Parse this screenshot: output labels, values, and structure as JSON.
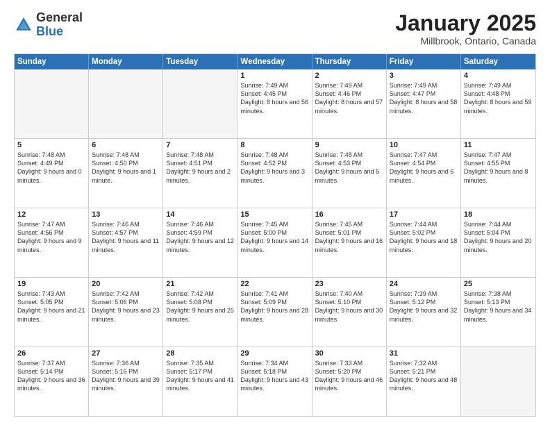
{
  "logo": {
    "general": "General",
    "blue": "Blue"
  },
  "header": {
    "title": "January 2025",
    "location": "Millbrook, Ontario, Canada"
  },
  "weekdays": [
    "Sunday",
    "Monday",
    "Tuesday",
    "Wednesday",
    "Thursday",
    "Friday",
    "Saturday"
  ],
  "weeks": [
    [
      {
        "day": "",
        "empty": true
      },
      {
        "day": "",
        "empty": true
      },
      {
        "day": "",
        "empty": true
      },
      {
        "day": "1",
        "sunrise": "7:49 AM",
        "sunset": "4:45 PM",
        "daylight": "8 hours and 56 minutes."
      },
      {
        "day": "2",
        "sunrise": "7:49 AM",
        "sunset": "4:46 PM",
        "daylight": "8 hours and 57 minutes."
      },
      {
        "day": "3",
        "sunrise": "7:49 AM",
        "sunset": "4:47 PM",
        "daylight": "8 hours and 58 minutes."
      },
      {
        "day": "4",
        "sunrise": "7:49 AM",
        "sunset": "4:48 PM",
        "daylight": "8 hours and 59 minutes."
      }
    ],
    [
      {
        "day": "5",
        "sunrise": "7:48 AM",
        "sunset": "4:49 PM",
        "daylight": "9 hours and 0 minutes."
      },
      {
        "day": "6",
        "sunrise": "7:48 AM",
        "sunset": "4:50 PM",
        "daylight": "9 hours and 1 minute."
      },
      {
        "day": "7",
        "sunrise": "7:48 AM",
        "sunset": "4:51 PM",
        "daylight": "9 hours and 2 minutes."
      },
      {
        "day": "8",
        "sunrise": "7:48 AM",
        "sunset": "4:52 PM",
        "daylight": "9 hours and 3 minutes."
      },
      {
        "day": "9",
        "sunrise": "7:48 AM",
        "sunset": "4:53 PM",
        "daylight": "9 hours and 5 minutes."
      },
      {
        "day": "10",
        "sunrise": "7:47 AM",
        "sunset": "4:54 PM",
        "daylight": "9 hours and 6 minutes."
      },
      {
        "day": "11",
        "sunrise": "7:47 AM",
        "sunset": "4:55 PM",
        "daylight": "9 hours and 8 minutes."
      }
    ],
    [
      {
        "day": "12",
        "sunrise": "7:47 AM",
        "sunset": "4:56 PM",
        "daylight": "9 hours and 9 minutes."
      },
      {
        "day": "13",
        "sunrise": "7:46 AM",
        "sunset": "4:57 PM",
        "daylight": "9 hours and 11 minutes."
      },
      {
        "day": "14",
        "sunrise": "7:46 AM",
        "sunset": "4:59 PM",
        "daylight": "9 hours and 12 minutes."
      },
      {
        "day": "15",
        "sunrise": "7:45 AM",
        "sunset": "5:00 PM",
        "daylight": "9 hours and 14 minutes."
      },
      {
        "day": "16",
        "sunrise": "7:45 AM",
        "sunset": "5:01 PM",
        "daylight": "9 hours and 16 minutes."
      },
      {
        "day": "17",
        "sunrise": "7:44 AM",
        "sunset": "5:02 PM",
        "daylight": "9 hours and 18 minutes."
      },
      {
        "day": "18",
        "sunrise": "7:44 AM",
        "sunset": "5:04 PM",
        "daylight": "9 hours and 20 minutes."
      }
    ],
    [
      {
        "day": "19",
        "sunrise": "7:43 AM",
        "sunset": "5:05 PM",
        "daylight": "9 hours and 21 minutes."
      },
      {
        "day": "20",
        "sunrise": "7:42 AM",
        "sunset": "5:06 PM",
        "daylight": "9 hours and 23 minutes."
      },
      {
        "day": "21",
        "sunrise": "7:42 AM",
        "sunset": "5:08 PM",
        "daylight": "9 hours and 25 minutes."
      },
      {
        "day": "22",
        "sunrise": "7:41 AM",
        "sunset": "5:09 PM",
        "daylight": "9 hours and 28 minutes."
      },
      {
        "day": "23",
        "sunrise": "7:40 AM",
        "sunset": "5:10 PM",
        "daylight": "9 hours and 30 minutes."
      },
      {
        "day": "24",
        "sunrise": "7:39 AM",
        "sunset": "5:12 PM",
        "daylight": "9 hours and 32 minutes."
      },
      {
        "day": "25",
        "sunrise": "7:38 AM",
        "sunset": "5:13 PM",
        "daylight": "9 hours and 34 minutes."
      }
    ],
    [
      {
        "day": "26",
        "sunrise": "7:37 AM",
        "sunset": "5:14 PM",
        "daylight": "9 hours and 36 minutes."
      },
      {
        "day": "27",
        "sunrise": "7:36 AM",
        "sunset": "5:16 PM",
        "daylight": "9 hours and 39 minutes."
      },
      {
        "day": "28",
        "sunrise": "7:35 AM",
        "sunset": "5:17 PM",
        "daylight": "9 hours and 41 minutes."
      },
      {
        "day": "29",
        "sunrise": "7:34 AM",
        "sunset": "5:18 PM",
        "daylight": "9 hours and 43 minutes."
      },
      {
        "day": "30",
        "sunrise": "7:33 AM",
        "sunset": "5:20 PM",
        "daylight": "9 hours and 46 minutes."
      },
      {
        "day": "31",
        "sunrise": "7:32 AM",
        "sunset": "5:21 PM",
        "daylight": "9 hours and 48 minutes."
      },
      {
        "day": "",
        "empty": true
      }
    ]
  ]
}
